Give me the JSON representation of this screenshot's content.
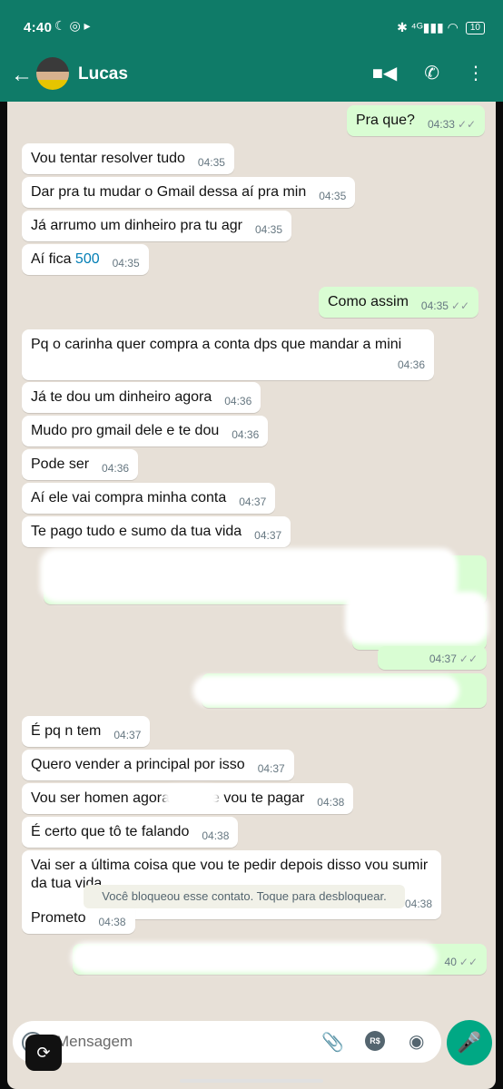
{
  "status_bar": {
    "time": "4:40",
    "left_icons": "☾ ◎ ▸",
    "signal": "✱ ⁴ᴳ▮▮▮ ◠",
    "battery": "10"
  },
  "header": {
    "contact_name": "Lucas",
    "back_icon": "arrow-left-icon",
    "video_icon": "video-icon",
    "call_icon": "phone-icon",
    "menu_icon": "more-vertical-icon"
  },
  "messages": [
    {
      "dir": "out",
      "text": "Pra que?",
      "time": "04:33",
      "ticks": "✓✓"
    },
    {
      "dir": "in",
      "text": "Vou tentar resolver tudo",
      "time": "04:35"
    },
    {
      "dir": "in",
      "text": "Dar pra tu mudar o Gmail dessa aí pra min",
      "time": "04:35"
    },
    {
      "dir": "in",
      "text": "Já arrumo um dinheiro pra tu agr",
      "time": "04:35"
    },
    {
      "dir": "in",
      "text": "Aí fica",
      "link": "500",
      "time": "04:35"
    },
    {
      "dir": "out",
      "text": "Como assim",
      "time": "04:35",
      "ticks": "✓✓"
    },
    {
      "dir": "in",
      "text": "Pq o carinha quer compra a conta dps que mandar a mini",
      "time": "04:36"
    },
    {
      "dir": "in",
      "text": "Já te dou um dinheiro agora",
      "time": "04:36"
    },
    {
      "dir": "in",
      "text": "Mudo pro gmail dele e te dou",
      "time": "04:36"
    },
    {
      "dir": "in",
      "text": "Pode ser",
      "time": "04:36"
    },
    {
      "dir": "in",
      "text": "Aí ele vai compra minha conta",
      "time": "04:37"
    },
    {
      "dir": "in",
      "text": "Te pago tudo e sumo da tua vida",
      "time": "04:37"
    },
    {
      "dir": "out",
      "text": "",
      "time": "04:37",
      "ticks": "✓✓",
      "partial_text": "ɔɔ"
    },
    {
      "dir": "in",
      "text": "É pq n tem",
      "time": "04:37"
    },
    {
      "dir": "in",
      "text": "Quero vender a principal por isso",
      "time": "04:37"
    },
    {
      "dir": "in",
      "text": "Vou ser homen agora",
      "text_after": "e vou te pagar",
      "time": "04:38"
    },
    {
      "dir": "in",
      "text": "É certo que tô te falando",
      "time": "04:38"
    },
    {
      "dir": "in",
      "text": "Vai ser a última coisa que vou te pedir depois disso vou sumir da tua vida",
      "time": "04:38"
    },
    {
      "dir": "in",
      "text": "Prometo",
      "time": "04:38"
    },
    {
      "dir": "out",
      "text": "",
      "time": "40",
      "ticks": "✓✓"
    }
  ],
  "system_notice": "Você bloqueou esse contato. Toque para desbloquear.",
  "composer": {
    "placeholder": "Mensagem",
    "attach_icon": "paperclip-icon",
    "payment_label": "R$",
    "camera_icon": "camera-icon",
    "mic_icon": "mic-icon"
  },
  "colors": {
    "header": "#0f7b68",
    "chat_bg": "#e7e0d7",
    "outgoing": "#d9fdd3",
    "incoming": "#ffffff",
    "accent": "#00a884",
    "link": "#027eb5"
  }
}
